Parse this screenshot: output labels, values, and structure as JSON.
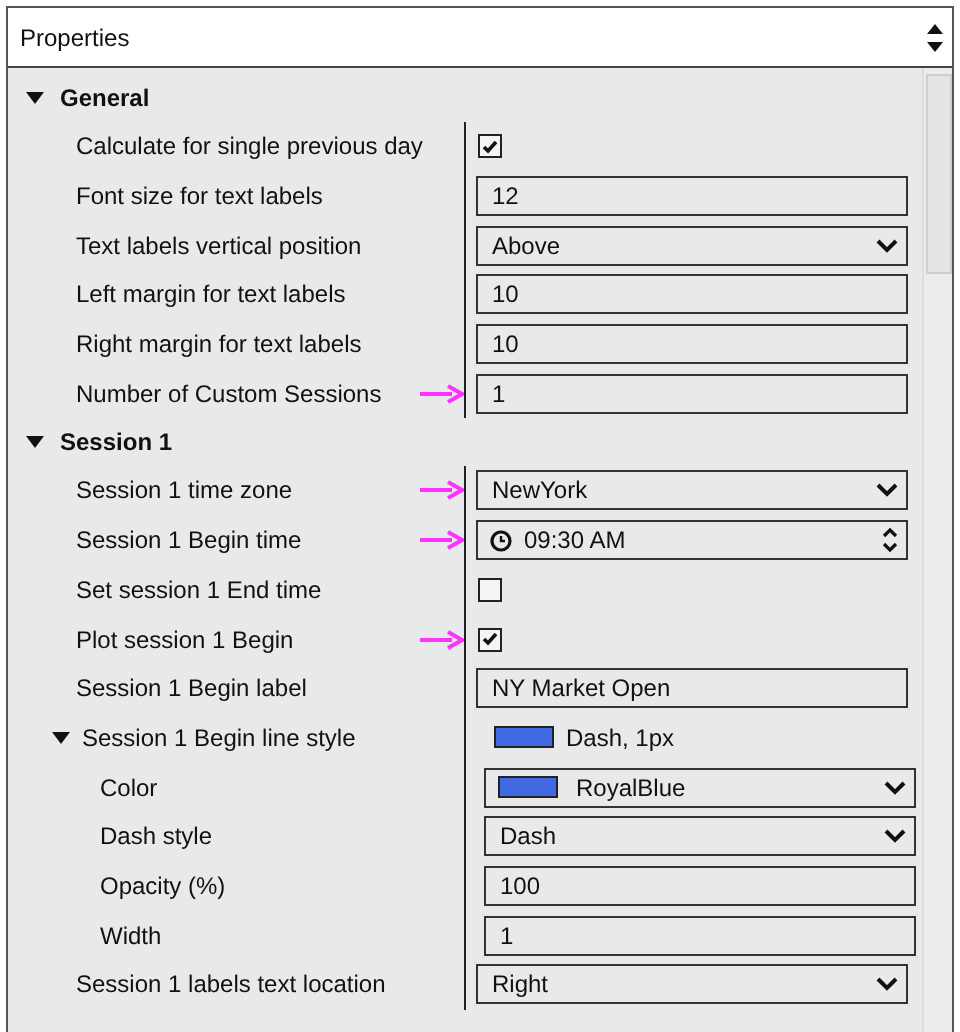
{
  "panel": {
    "title": "Properties"
  },
  "sections": [
    {
      "title": "General",
      "expanded": true,
      "rows": [
        {
          "label": "Calculate for single previous day",
          "kind": "checkbox",
          "checked": true,
          "arrow": false
        },
        {
          "label": "Font size for text labels",
          "kind": "text",
          "value": "12",
          "arrow": false
        },
        {
          "label": "Text labels vertical position",
          "kind": "dropdown",
          "value": "Above",
          "arrow": false
        },
        {
          "label": "Left margin for text labels",
          "kind": "text",
          "value": "10",
          "arrow": false
        },
        {
          "label": "Right margin for text labels",
          "kind": "text",
          "value": "10",
          "arrow": false
        },
        {
          "label": "Number of Custom Sessions",
          "kind": "text",
          "value": "1",
          "arrow": true
        }
      ]
    },
    {
      "title": "Session 1",
      "expanded": true,
      "rows": [
        {
          "label": "Session 1 time zone",
          "kind": "dropdown",
          "value": "NewYork",
          "arrow": true
        },
        {
          "label": "Session 1 Begin time",
          "kind": "time",
          "value": "09:30 AM",
          "arrow": true
        },
        {
          "label": "Set session 1 End time",
          "kind": "checkbox",
          "checked": false,
          "arrow": false
        },
        {
          "label": "Plot session 1 Begin",
          "kind": "checkbox",
          "checked": true,
          "arrow": true
        },
        {
          "label": "Session 1 Begin label",
          "kind": "text",
          "value": "NY Market Open",
          "arrow": false
        },
        {
          "label": "Session 1 Begin line style",
          "kind": "group",
          "expanded": true,
          "summary": "Dash, 1px",
          "color": "#4169e1",
          "arrow": false,
          "children": [
            {
              "label": "Color",
              "kind": "color",
              "value": "RoyalBlue",
              "color": "#4169e1",
              "arrow": false
            },
            {
              "label": "Dash style",
              "kind": "dropdown",
              "value": "Dash",
              "arrow": false
            },
            {
              "label": "Opacity (%)",
              "kind": "text",
              "value": "100",
              "arrow": false
            },
            {
              "label": "Width",
              "kind": "text",
              "value": "1",
              "arrow": false
            }
          ]
        },
        {
          "label": "Session 1 labels text location",
          "kind": "dropdown",
          "value": "Right",
          "arrow": false
        }
      ]
    }
  ]
}
